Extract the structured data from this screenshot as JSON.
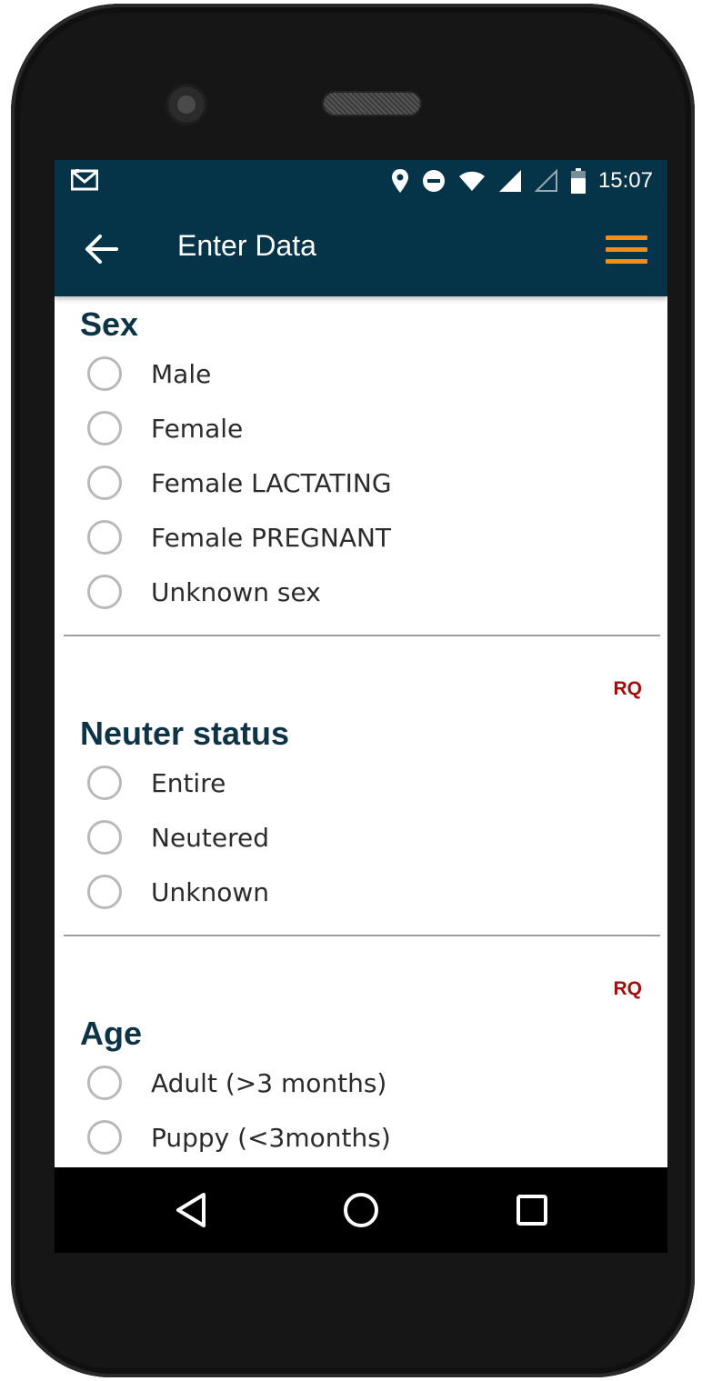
{
  "status_bar": {
    "time": "15:07",
    "icons": [
      "gmail-icon",
      "location-icon",
      "do-not-disturb-icon",
      "wifi-icon",
      "signal-icon",
      "signal-empty-icon",
      "battery-icon"
    ]
  },
  "app_bar": {
    "title": "Enter Data",
    "back_icon": "arrow-left-icon",
    "menu_icon": "hamburger-menu-icon",
    "menu_color": "#f28c1b"
  },
  "sections": [
    {
      "title": "Sex",
      "required_badge": "",
      "options": [
        "Male",
        "Female",
        "Female LACTATING",
        "Female PREGNANT",
        "Unknown sex"
      ]
    },
    {
      "title": "Neuter status",
      "required_badge": "RQ",
      "options": [
        "Entire",
        "Neutered",
        "Unknown"
      ]
    },
    {
      "title": "Age",
      "required_badge": "RQ",
      "options": [
        "Adult (>3 months)",
        "Puppy (<3months)"
      ]
    }
  ],
  "nav_bar": {
    "icons": [
      "back-triangle-icon",
      "home-circle-icon",
      "recents-square-icon"
    ]
  },
  "colors": {
    "primary": "#053449",
    "accent": "#f28c1b",
    "required": "#a50c0c",
    "heading": "#0d3347"
  }
}
